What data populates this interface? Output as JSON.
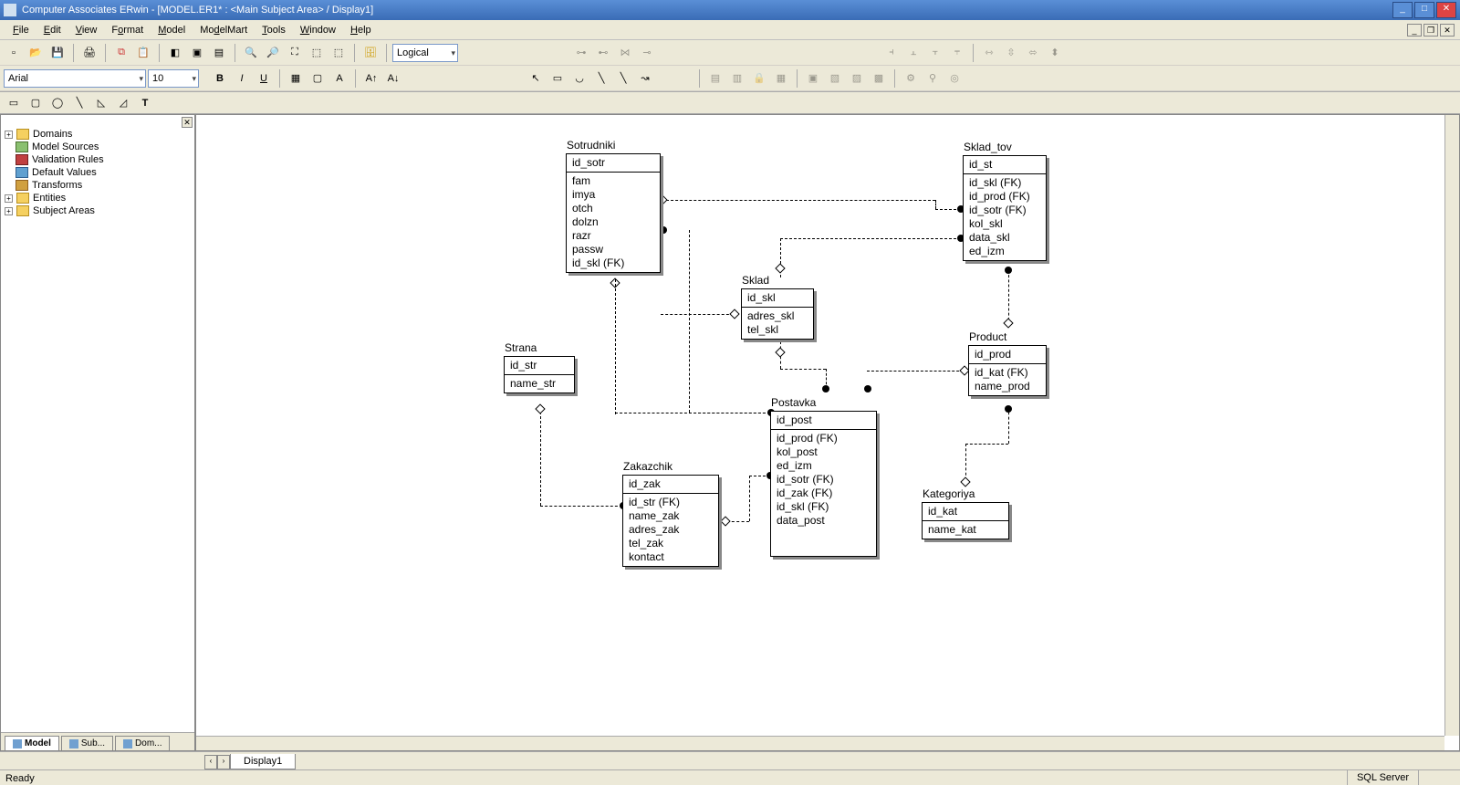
{
  "window": {
    "title": "Computer Associates ERwin - [MODEL.ER1* : <Main Subject Area> / Display1]"
  },
  "menu": {
    "items": [
      "File",
      "Edit",
      "View",
      "Format",
      "Model",
      "ModelMart",
      "Tools",
      "Window",
      "Help"
    ]
  },
  "toolbar": {
    "model_type": "Logical",
    "font_name": "Arial",
    "font_size": "10"
  },
  "tree": {
    "items": [
      {
        "label": "Domains",
        "icon": "folder",
        "expandable": true
      },
      {
        "label": "Model Sources",
        "icon": "cube",
        "expandable": false
      },
      {
        "label": "Validation Rules",
        "icon": "vr",
        "expandable": false
      },
      {
        "label": "Default Values",
        "icon": "dv",
        "expandable": false
      },
      {
        "label": "Transforms",
        "icon": "tr",
        "expandable": false
      },
      {
        "label": "Entities",
        "icon": "folder",
        "expandable": true
      },
      {
        "label": "Subject Areas",
        "icon": "folder",
        "expandable": true
      }
    ],
    "tabs": [
      "Model",
      "Sub...",
      "Dom..."
    ]
  },
  "entities": {
    "sotrudniki": {
      "name": "Sotrudniki",
      "pk": [
        "id_sotr"
      ],
      "attrs": [
        "fam",
        "imya",
        "otch",
        "dolzn",
        "razr",
        "passw",
        "id_skl (FK)"
      ]
    },
    "sklad_tov": {
      "name": "Sklad_tov",
      "pk": [
        "id_st"
      ],
      "attrs": [
        "id_skl (FK)",
        "id_prod (FK)",
        "id_sotr (FK)",
        "kol_skl",
        "data_skl",
        "ed_izm"
      ]
    },
    "sklad": {
      "name": "Sklad",
      "pk": [
        "id_skl"
      ],
      "attrs": [
        "adres_skl",
        "tel_skl"
      ]
    },
    "strana": {
      "name": "Strana",
      "pk": [
        "id_str"
      ],
      "attrs": [
        "name_str"
      ]
    },
    "product": {
      "name": "Product",
      "pk": [
        "id_prod"
      ],
      "attrs": [
        "id_kat (FK)",
        "name_prod"
      ]
    },
    "postavka": {
      "name": "Postavka",
      "pk": [
        "id_post"
      ],
      "attrs": [
        "id_prod (FK)",
        "kol_post",
        "ed_izm",
        "id_sotr (FK)",
        "id_zak (FK)",
        "id_skl (FK)",
        "data_post"
      ]
    },
    "zakazchik": {
      "name": "Zakazchik",
      "pk": [
        "id_zak"
      ],
      "attrs": [
        "id_str (FK)",
        "name_zak",
        "adres_zak",
        "tel_zak",
        "kontact"
      ]
    },
    "kategoriya": {
      "name": "Kategoriya",
      "pk": [
        "id_kat"
      ],
      "attrs": [
        "name_kat"
      ]
    }
  },
  "display_tab": "Display1",
  "status": {
    "left": "Ready",
    "right": "SQL Server"
  }
}
